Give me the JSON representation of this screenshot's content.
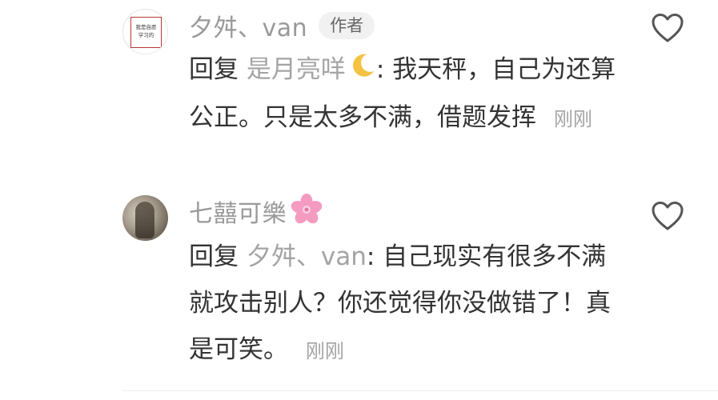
{
  "comments": [
    {
      "avatar_text_line1": "我是自愿",
      "avatar_text_line2": "学习的",
      "author": "夕舛、van",
      "author_badge": "作者",
      "reply_prefix": "回复",
      "reply_to": "是月亮咩",
      "reply_to_emoji": "crescent-moon-icon",
      "colon": ":",
      "text": " 我天秤，自己为还算公正。只是太多不满，借题发挥",
      "time": "刚刚",
      "like_icon": "heart-outline-icon"
    },
    {
      "author": "七囍可樂",
      "author_emoji": "cherry-blossom-icon",
      "reply_prefix": "回复",
      "reply_to": "夕舛、van",
      "colon": ":",
      "text": " 自己现实有很多不满就攻击别人？你还觉得你没做错了！真是可笑。",
      "time": "刚刚",
      "like_icon": "heart-outline-icon"
    }
  ],
  "colors": {
    "name_gray": "#999999",
    "text": "#333333",
    "badge_bg": "#f1f1f1",
    "moon": "#f5c242",
    "blossom": "#f49bc1"
  }
}
